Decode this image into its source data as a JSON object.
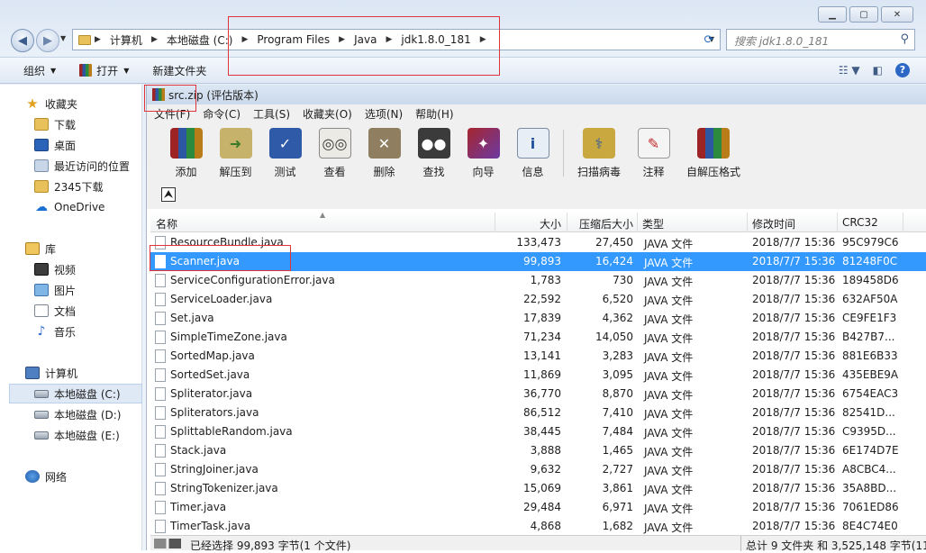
{
  "explorer": {
    "address": {
      "crumbs": [
        "计算机",
        "本地磁盘 (C:)",
        "Program Files",
        "Java",
        "jdk1.8.0_181"
      ]
    },
    "search_placeholder": "搜索 jdk1.8.0_181",
    "toolbar": {
      "organize": "组织",
      "open": "打开",
      "new_folder": "新建文件夹"
    },
    "nav": {
      "favorites": "收藏夹",
      "downloads": "下载",
      "desktop": "桌面",
      "recent": "最近访问的位置",
      "downloads2345": "2345下载",
      "onedrive": "OneDrive",
      "library": "库",
      "video": "视频",
      "pictures": "图片",
      "documents": "文档",
      "music": "音乐",
      "computer": "计算机",
      "drive_c": "本地磁盘 (C:)",
      "drive_d": "本地磁盘 (D:)",
      "drive_e": "本地磁盘 (E:)",
      "network": "网络"
    }
  },
  "winrar": {
    "title": "src.zip (评估版本)",
    "menu": [
      "文件(F)",
      "命令(C)",
      "工具(S)",
      "收藏夹(O)",
      "选项(N)",
      "帮助(H)"
    ],
    "tools": [
      "添加",
      "解压到",
      "测试",
      "查看",
      "删除",
      "查找",
      "向导",
      "信息",
      "扫描病毒",
      "注释",
      "自解压格式"
    ],
    "columns": {
      "name": "名称",
      "size": "大小",
      "packed": "压缩后大小",
      "type": "类型",
      "modified": "修改时间",
      "crc": "CRC32"
    },
    "files": [
      {
        "name": "ResourceBundle.java",
        "size": "133,473",
        "packed": "27,450",
        "type": "JAVA 文件",
        "modified": "2018/7/7 15:36",
        "crc": "95C979C6"
      },
      {
        "name": "Scanner.java",
        "size": "99,893",
        "packed": "16,424",
        "type": "JAVA 文件",
        "modified": "2018/7/7 15:36",
        "crc": "81248F0C"
      },
      {
        "name": "ServiceConfigurationError.java",
        "size": "1,783",
        "packed": "730",
        "type": "JAVA 文件",
        "modified": "2018/7/7 15:36",
        "crc": "189458D6"
      },
      {
        "name": "ServiceLoader.java",
        "size": "22,592",
        "packed": "6,520",
        "type": "JAVA 文件",
        "modified": "2018/7/7 15:36",
        "crc": "632AF50A"
      },
      {
        "name": "Set.java",
        "size": "17,839",
        "packed": "4,362",
        "type": "JAVA 文件",
        "modified": "2018/7/7 15:36",
        "crc": "CE9FE1F3"
      },
      {
        "name": "SimpleTimeZone.java",
        "size": "71,234",
        "packed": "14,050",
        "type": "JAVA 文件",
        "modified": "2018/7/7 15:36",
        "crc": "B427B7..."
      },
      {
        "name": "SortedMap.java",
        "size": "13,141",
        "packed": "3,283",
        "type": "JAVA 文件",
        "modified": "2018/7/7 15:36",
        "crc": "881E6B33"
      },
      {
        "name": "SortedSet.java",
        "size": "11,869",
        "packed": "3,095",
        "type": "JAVA 文件",
        "modified": "2018/7/7 15:36",
        "crc": "435EBE9A"
      },
      {
        "name": "Spliterator.java",
        "size": "36,770",
        "packed": "8,870",
        "type": "JAVA 文件",
        "modified": "2018/7/7 15:36",
        "crc": "6754EAC3"
      },
      {
        "name": "Spliterators.java",
        "size": "86,512",
        "packed": "7,410",
        "type": "JAVA 文件",
        "modified": "2018/7/7 15:36",
        "crc": "82541D..."
      },
      {
        "name": "SplittableRandom.java",
        "size": "38,445",
        "packed": "7,484",
        "type": "JAVA 文件",
        "modified": "2018/7/7 15:36",
        "crc": "C9395D..."
      },
      {
        "name": "Stack.java",
        "size": "3,888",
        "packed": "1,465",
        "type": "JAVA 文件",
        "modified": "2018/7/7 15:36",
        "crc": "6E174D7E"
      },
      {
        "name": "StringJoiner.java",
        "size": "9,632",
        "packed": "2,727",
        "type": "JAVA 文件",
        "modified": "2018/7/7 15:36",
        "crc": "A8CBC4..."
      },
      {
        "name": "StringTokenizer.java",
        "size": "15,069",
        "packed": "3,861",
        "type": "JAVA 文件",
        "modified": "2018/7/7 15:36",
        "crc": "35A8BD..."
      },
      {
        "name": "Timer.java",
        "size": "29,484",
        "packed": "6,971",
        "type": "JAVA 文件",
        "modified": "2018/7/7 15:36",
        "crc": "7061ED86"
      },
      {
        "name": "TimerTask.java",
        "size": "4,868",
        "packed": "1,682",
        "type": "JAVA 文件",
        "modified": "2018/7/7 15:36",
        "crc": "8E4C74E0"
      }
    ],
    "status": {
      "left": "已经选择 99,893 字节(1 个文件)",
      "right": "总计 9 文件夹 和 3,525,148 字节(11("
    }
  }
}
